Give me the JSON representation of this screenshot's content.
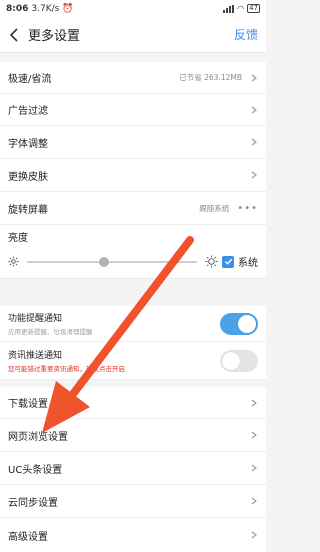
{
  "status_bar": {
    "time": "8:06",
    "speed": "3.7K/s",
    "battery": "47"
  },
  "header": {
    "title": "更多设置",
    "feedback": "反馈"
  },
  "settings": {
    "speed_mode": {
      "label": "极速/省流",
      "value": "已节省 263.12MB"
    },
    "ad_filter": {
      "label": "广告过滤"
    },
    "font_size": {
      "label": "字体调整"
    },
    "skin": {
      "label": "更换皮肤"
    },
    "rotate": {
      "label": "旋转屏幕",
      "value": "跟随系统",
      "more": "•••"
    },
    "brightness": {
      "label": "亮度",
      "level": 0.45,
      "system_checked": true,
      "system_label": "系统"
    },
    "feature_notify": {
      "title": "功能提醒通知",
      "subtitle": "应用更新提醒、垃圾清理提醒",
      "enabled": true
    },
    "news_push": {
      "title": "资讯推送通知",
      "subtitle": "您可能错过重要资讯通知，建议点击开启",
      "enabled": false
    },
    "download": {
      "label": "下载设置"
    },
    "web_browse": {
      "label": "网页浏览设置"
    },
    "uc_headline": {
      "label": "UC头条设置"
    },
    "cloud_sync": {
      "label": "云同步设置"
    },
    "advanced": {
      "label": "高级设置"
    }
  },
  "colors": {
    "accent": "#3a8fe8",
    "toggle_on": "#4aa3e8",
    "warning_text": "#d9342b",
    "annotation_arrow": "#f0522c"
  }
}
